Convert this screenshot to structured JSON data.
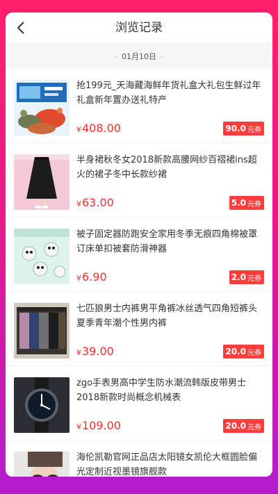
{
  "header": {
    "title": "浏览记录"
  },
  "date_label": "01月10日",
  "date_dash_left": "-",
  "date_dash_right": "-",
  "currency_symbol": "¥",
  "coupon_unit": "元券",
  "items": [
    {
      "name": "抢199元_天海藏海鲜年货礼盒大礼包生鲜过年礼盒新年置办送礼特产",
      "price": "408.00",
      "coupon": "90.0",
      "thumb": "seafood-gift-box"
    },
    {
      "name": "半身裙秋冬女2018新款高腰网纱百褶裙ins超火的裙子冬中长款纱裙",
      "price": "63.00",
      "coupon": "5.0",
      "thumb": "black-tulle-skirt"
    },
    {
      "name": "被子固定器防跑安全家用冬季无痕四角棉被罩订床单扣被套防滑神器",
      "price": "6.90",
      "coupon": "2.0",
      "thumb": "quilt-clips"
    },
    {
      "name": "七匹狼男士内裤男平角裤冰丝透气四角短裤头夏季青年潮个性男内裤",
      "price": "39.00",
      "coupon": "20.0",
      "thumb": "mens-underwear-box"
    },
    {
      "name": "zgo手表男高中学生防水潮流韩版皮带男士2018新款时尚概念机械表",
      "price": "109.00",
      "coupon": "20.0",
      "thumb": "mens-watch"
    },
    {
      "name": "海伦凯勒官网正品店太阳镜女凯伦大框圆脸偏光定制近视墨镜旗舰款",
      "price": "",
      "coupon": "",
      "thumb": "sunglasses-model"
    }
  ],
  "colors": {
    "price": "#ff2b2b",
    "coupon_bg": "#ff3d3d",
    "gradient_top": "#ff1f6b",
    "gradient_bottom": "#b41ccf"
  }
}
